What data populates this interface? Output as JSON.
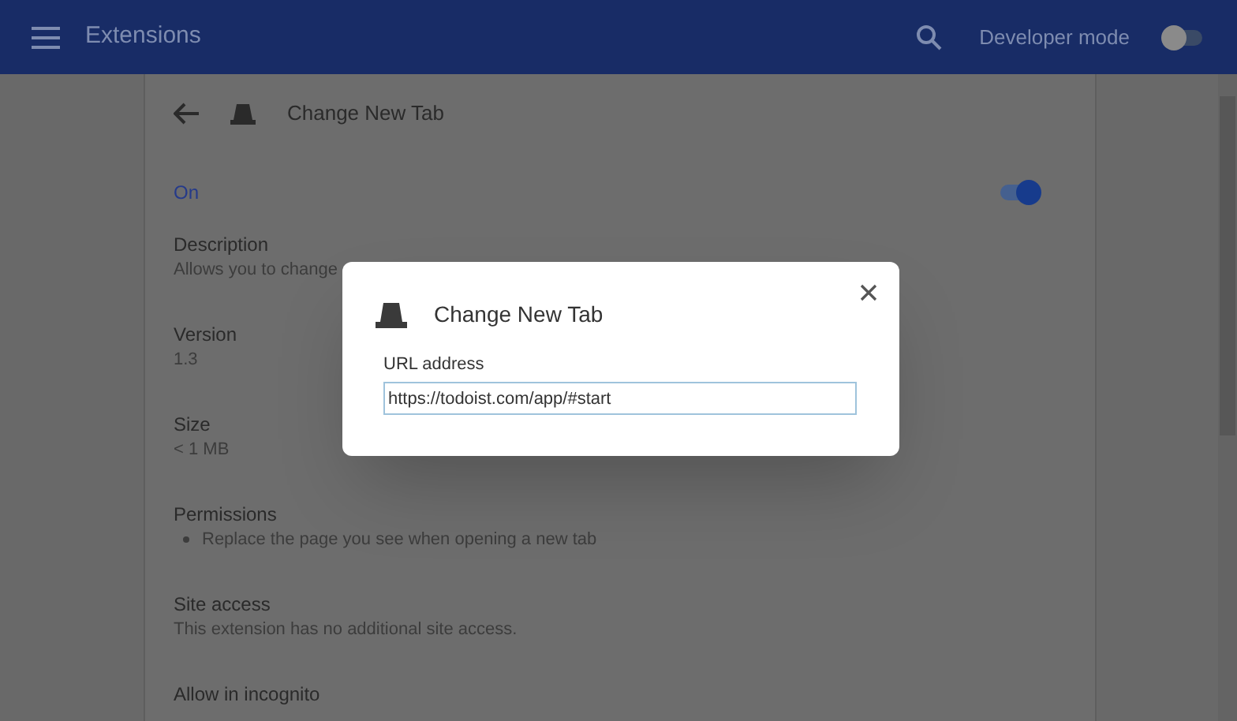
{
  "header": {
    "title": "Extensions",
    "developer_mode": {
      "label": "Developer mode",
      "on": false
    }
  },
  "detail": {
    "title": "Change New Tab",
    "status_label": "On",
    "enabled": true,
    "sections": [
      {
        "kind": "text",
        "heading": "Description",
        "text": "Allows you to change"
      },
      {
        "kind": "text",
        "heading": "Version",
        "text": "1.3"
      },
      {
        "kind": "text",
        "heading": "Size",
        "text": "< 1 MB"
      },
      {
        "kind": "bullets",
        "heading": "Permissions",
        "items": [
          "Replace the page you see when opening a new tab"
        ]
      },
      {
        "kind": "text",
        "heading": "Site access",
        "text": "This extension has no additional site access."
      },
      {
        "kind": "heading",
        "heading": "Allow in incognito"
      }
    ]
  },
  "dialog": {
    "title": "Change New Tab",
    "field": {
      "label": "URL address",
      "value": "https://todoist.com/app/#start"
    }
  }
}
